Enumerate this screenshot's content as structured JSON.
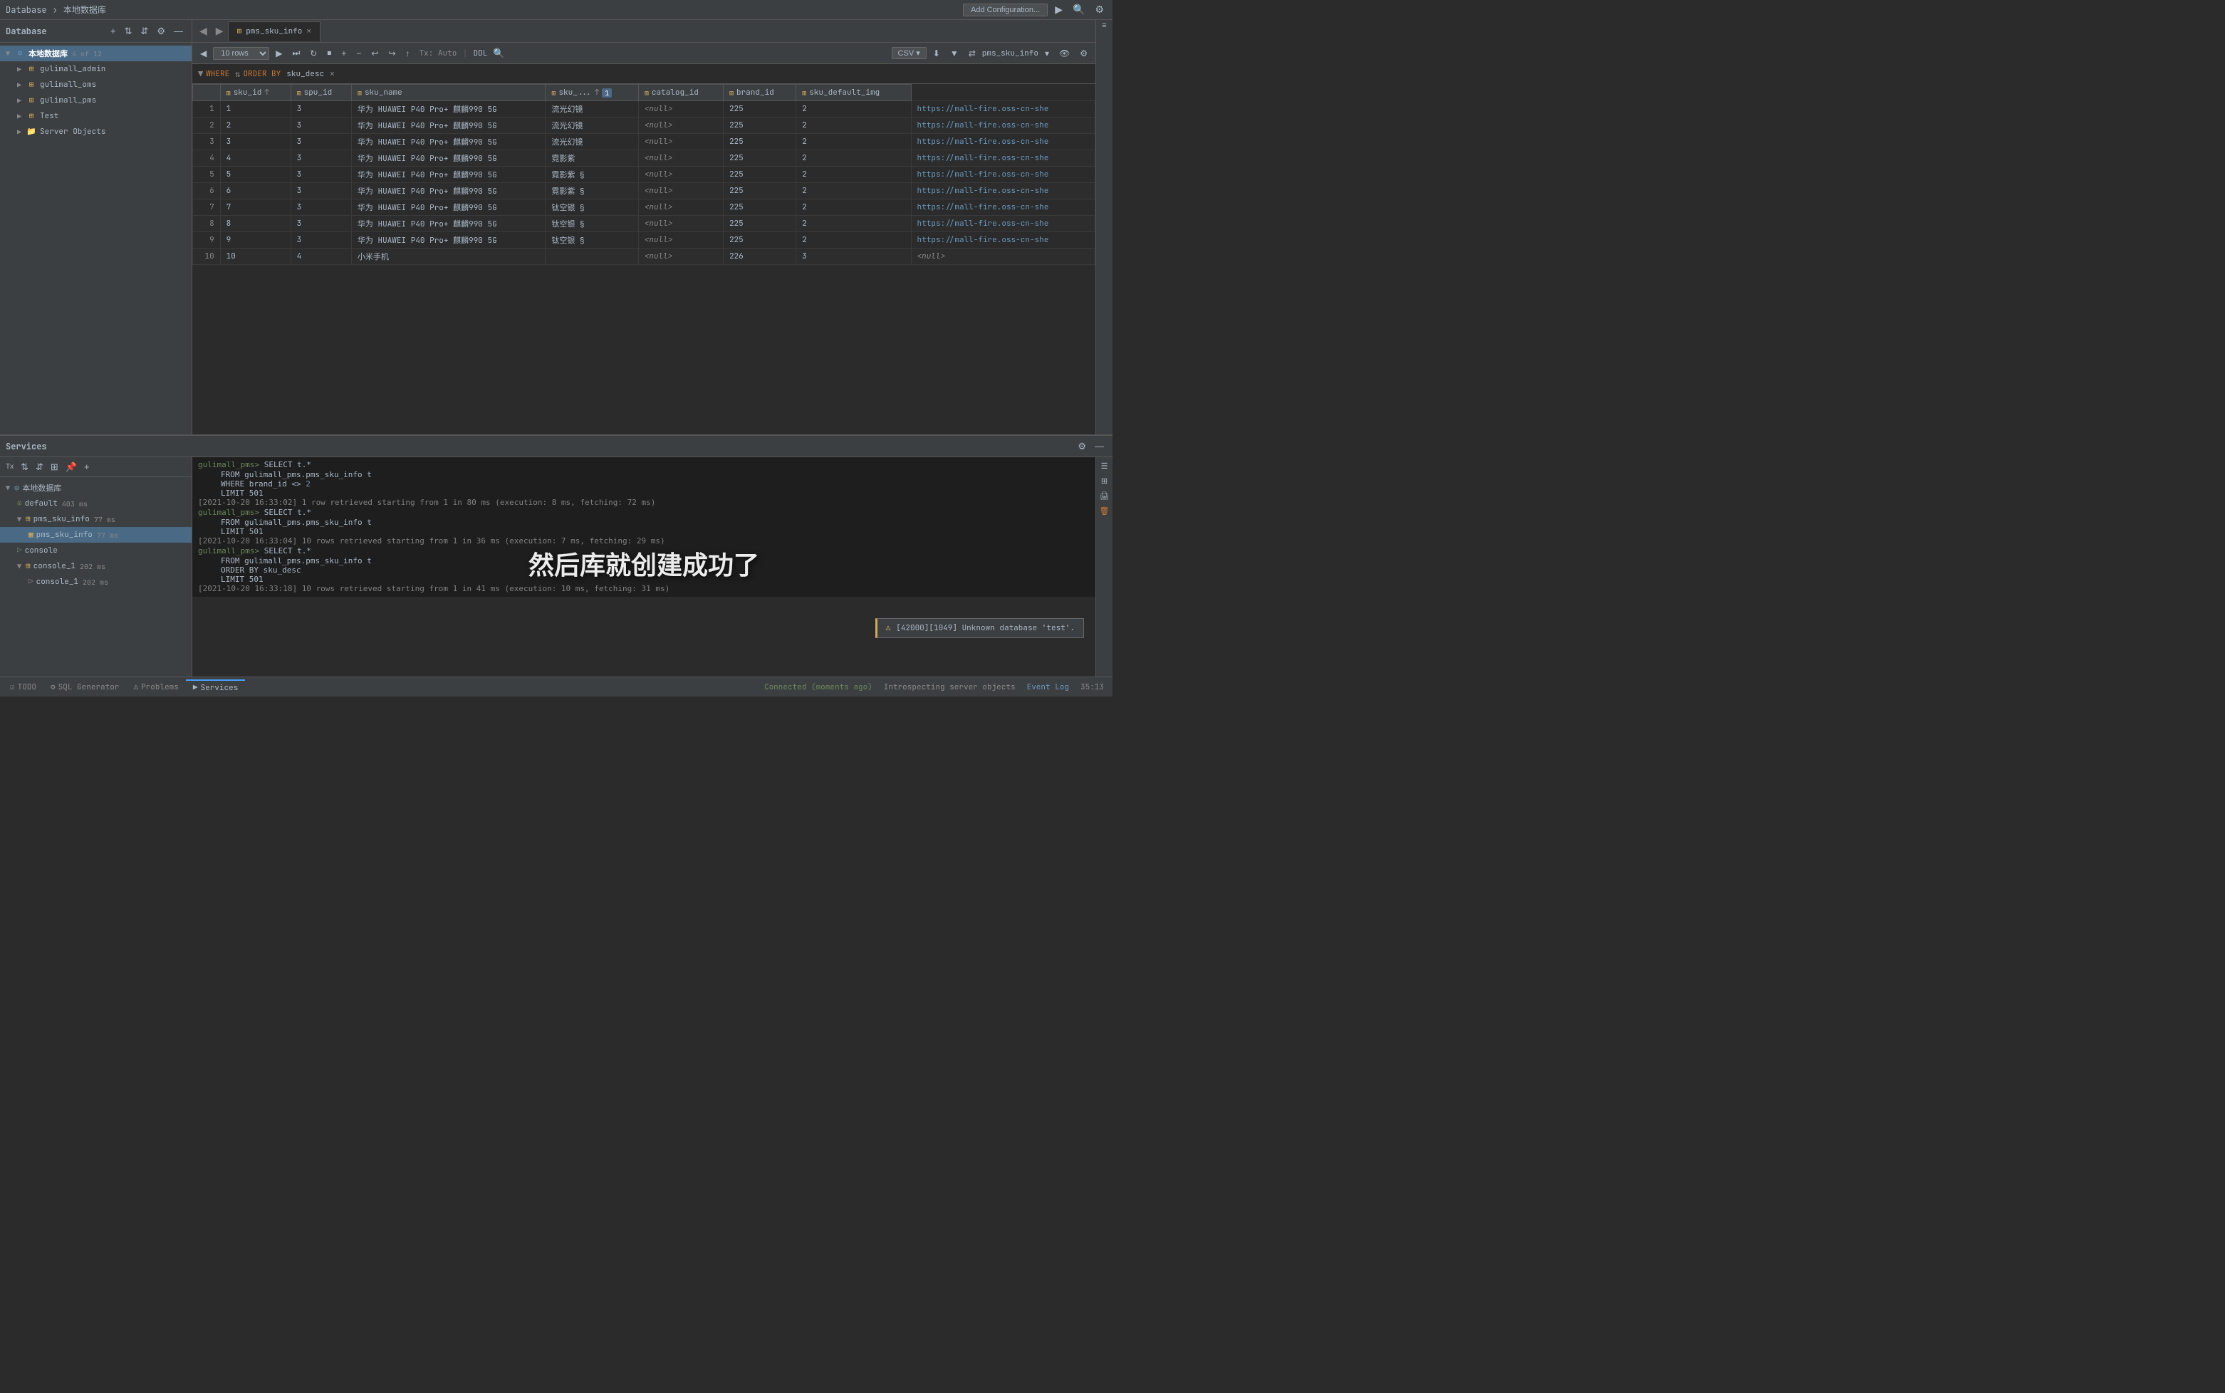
{
  "titlebar": {
    "breadcrumb": "Database",
    "sep": "›",
    "db_name": "本地数据库",
    "add_config_label": "Add Configuration...",
    "run_icon": "▶",
    "search_icon": "🔍",
    "settings_icon": "⚙"
  },
  "sidebar": {
    "title": "Database",
    "items": [
      {
        "id": "local-db",
        "label": "本地数据库",
        "badge": "4 of 12",
        "level": 0,
        "type": "db",
        "expanded": true,
        "selected": true
      },
      {
        "id": "gulimall-admin",
        "label": "gulimall_admin",
        "level": 1,
        "type": "schema",
        "expanded": false
      },
      {
        "id": "gulimall-oms",
        "label": "gulimall_oms",
        "level": 1,
        "type": "schema",
        "expanded": false
      },
      {
        "id": "gulimall-pms",
        "label": "gulimall_pms",
        "level": 1,
        "type": "schema",
        "expanded": false
      },
      {
        "id": "test",
        "label": "Test",
        "level": 1,
        "type": "schema",
        "expanded": false
      },
      {
        "id": "server-objects",
        "label": "Server Objects",
        "level": 1,
        "type": "folder",
        "expanded": false
      }
    ]
  },
  "tabs": {
    "active": "pms_sku_info",
    "items": [
      {
        "id": "pms_sku_info",
        "label": "pms_sku_info",
        "icon": "⊞",
        "closeable": true
      }
    ]
  },
  "query_toolbar": {
    "rows_select": "10 rows",
    "tx_label": "Tx: Auto",
    "ddl_label": "DDL",
    "csv_label": "CSV ▾",
    "export_icon": "⬇",
    "table_name": "pms_sku_info"
  },
  "filter_bar": {
    "where_label": "WHERE",
    "orderby_label": "ORDER BY",
    "orderby_field": "sku_desc"
  },
  "grid": {
    "columns": [
      {
        "id": "row_num",
        "label": "",
        "width": 40
      },
      {
        "id": "sku_id",
        "label": "sku_id",
        "icon": "⊞",
        "sort": "↑"
      },
      {
        "id": "spu_id",
        "label": "spu_id",
        "icon": "⊞"
      },
      {
        "id": "sku_name",
        "label": "sku_name",
        "icon": "⊞"
      },
      {
        "id": "sku_dot",
        "label": "sku_...",
        "icon": "⊞",
        "sort": "↑",
        "badge": "1"
      },
      {
        "id": "catalog_id",
        "label": "catalog_id",
        "icon": "⊞"
      },
      {
        "id": "brand_id",
        "label": "brand_id",
        "icon": "⊞"
      },
      {
        "id": "sku_default_img",
        "label": "sku_default_img",
        "icon": "⊞"
      }
    ],
    "rows": [
      [
        1,
        1,
        3,
        "华为 HUAWEI P40 Pro+ 麒麟990 5G",
        "流光幻镜",
        "<null>",
        225,
        2,
        "https://mall-fire.oss-cn-she"
      ],
      [
        2,
        2,
        3,
        "华为 HUAWEI P40 Pro+ 麒麟990 5G",
        "流光幻镜",
        "<null>",
        225,
        2,
        "https://mall-fire.oss-cn-she"
      ],
      [
        3,
        3,
        3,
        "华为 HUAWEI P40 Pro+ 麒麟990 5G",
        "流光幻镜",
        "<null>",
        225,
        2,
        "https://mall-fire.oss-cn-she"
      ],
      [
        4,
        4,
        3,
        "华为 HUAWEI P40 Pro+ 麒麟990 5G",
        "霓影紫",
        "<null>",
        225,
        2,
        "https://mall-fire.oss-cn-she"
      ],
      [
        5,
        5,
        3,
        "华为 HUAWEI P40 Pro+ 麒麟990 5G",
        "霓影紫 §",
        "<null>",
        225,
        2,
        "https://mall-fire.oss-cn-she"
      ],
      [
        6,
        6,
        3,
        "华为 HUAWEI P40 Pro+ 麒麟990 5G",
        "霓影紫 §",
        "<null>",
        225,
        2,
        "https://mall-fire.oss-cn-she"
      ],
      [
        7,
        7,
        3,
        "华为 HUAWEI P40 Pro+ 麒麟990 5G",
        "钛空银 §",
        "<null>",
        225,
        2,
        "https://mall-fire.oss-cn-she"
      ],
      [
        8,
        8,
        3,
        "华为 HUAWEI P40 Pro+ 麒麟990 5G",
        "钛空银 §",
        "<null>",
        225,
        2,
        "https://mall-fire.oss-cn-she"
      ],
      [
        9,
        9,
        3,
        "华为 HUAWEI P40 Pro+ 麒麟990 5G",
        "钛空银 §",
        "<null>",
        225,
        2,
        "https://mall-fire.oss-cn-she"
      ],
      [
        10,
        10,
        4,
        "小米手机",
        "",
        "<null>",
        226,
        3,
        "<null>"
      ]
    ]
  },
  "services": {
    "title": "Services",
    "tree": [
      {
        "id": "local-db-svc",
        "label": "本地数据库",
        "level": 0,
        "type": "db",
        "expanded": true
      },
      {
        "id": "default",
        "label": "default",
        "time": "403 ms",
        "level": 1,
        "type": "session"
      },
      {
        "id": "pms-sku-info",
        "label": "pms_sku_info",
        "time": "77 ms",
        "level": 1,
        "type": "session",
        "expanded": true,
        "active": true
      },
      {
        "id": "pms-sku-info-query",
        "label": "pms_sku_info",
        "time": "77 ms",
        "level": 2,
        "type": "query",
        "active": true
      },
      {
        "id": "console",
        "label": "console",
        "level": 1,
        "type": "console"
      },
      {
        "id": "console-1",
        "label": "console_1",
        "time": "202 ms",
        "level": 1,
        "type": "session",
        "expanded": true
      },
      {
        "id": "console-1-query",
        "label": "console_1",
        "time": "202 ms",
        "level": 2,
        "type": "query"
      }
    ],
    "console_lines": [
      {
        "type": "prompt",
        "prompt": "gulimall_pms>",
        "cmd": "SELECT t.*"
      },
      {
        "type": "indent",
        "text": "FROM gulimall_pms.pms_sku_info t"
      },
      {
        "type": "indent",
        "text": "WHERE brand_id <> 2"
      },
      {
        "type": "indent",
        "text": "LIMIT 501"
      },
      {
        "type": "result",
        "text": "[2021-10-20 16:33:02] 1 row retrieved starting from 1 in 80 ms (execution: 8 ms, fetching: 72 ms)"
      },
      {
        "type": "prompt",
        "prompt": "gulimall_pms>",
        "cmd": "SELECT t.*"
      },
      {
        "type": "indent",
        "text": "FROM gulimall_pms.pms_sku_info t"
      },
      {
        "type": "indent",
        "text": "LIMIT 501"
      },
      {
        "type": "result",
        "text": "[2021-10-20 16:33:04] 10 rows retrieved starting from 1 in 36 ms (execution: 7 ms, fetching: 29 ms)"
      },
      {
        "type": "prompt",
        "prompt": "gulimall_pms>",
        "cmd": "SELECT t.*"
      },
      {
        "type": "indent",
        "text": "FROM gulimall_pms.pms_sku_info t"
      },
      {
        "type": "indent",
        "text": "ORDER BY sku_desc"
      },
      {
        "type": "indent",
        "text": "LIMIT 501"
      },
      {
        "type": "result",
        "text": "[2021-10-20 16:33:18] 10 rows retrieved starting from 1 in 41 ms (execution: 10 ms, fetching: 31 ms)"
      }
    ]
  },
  "overlay": {
    "text": "然后库就创建成功了"
  },
  "notification": {
    "icon": "⚠",
    "text": "[42000][1049] Unknown database 'test'."
  },
  "statusbar": {
    "left": "Connected (moments ago)",
    "center": "Introspecting server objects",
    "right": "Event Log",
    "time": "35:13"
  },
  "bottom_tabs": [
    {
      "id": "todo",
      "label": "TODO",
      "icon": "☑"
    },
    {
      "id": "sql-gen",
      "label": "SQL Generator",
      "icon": "⚙"
    },
    {
      "id": "problems",
      "label": "Problems",
      "icon": "⚠"
    },
    {
      "id": "services",
      "label": "Services",
      "icon": "▶",
      "active": true
    }
  ]
}
